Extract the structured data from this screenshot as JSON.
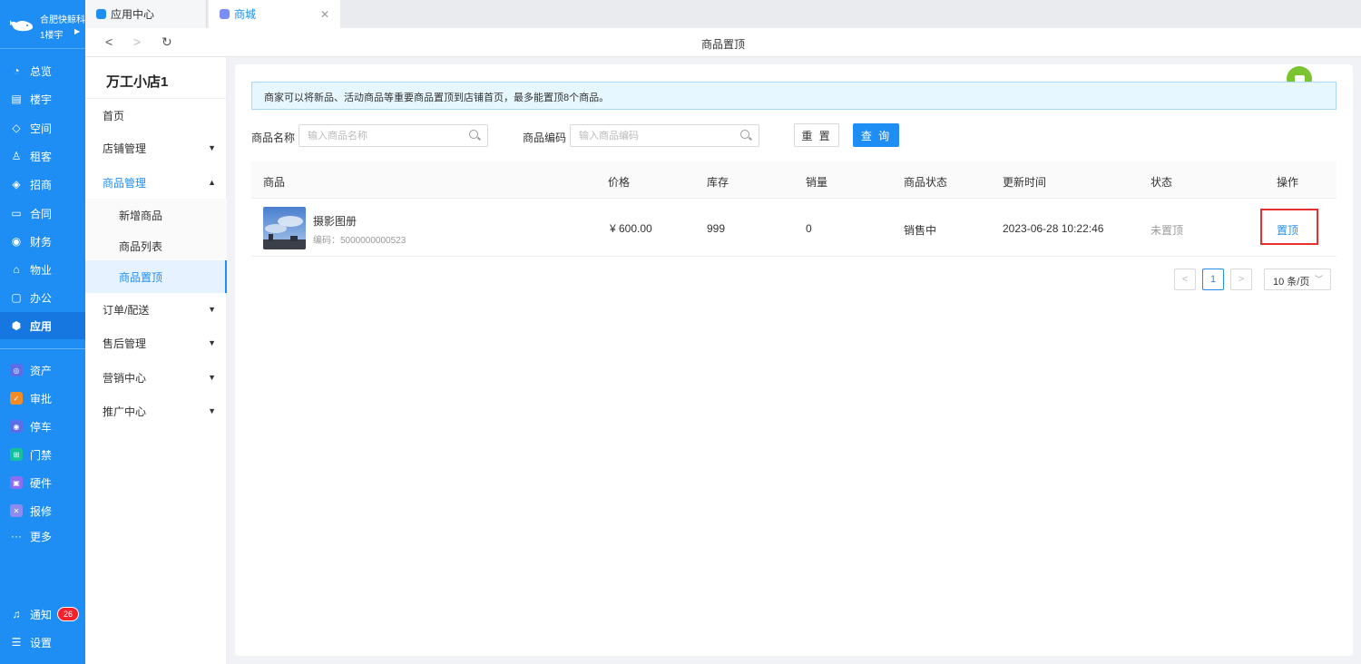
{
  "sidebar": {
    "brand": {
      "name": "合肥快鲸科",
      "building": "1楼宇"
    },
    "items": [
      {
        "label": "总览",
        "icon": "dashboard-icon"
      },
      {
        "label": "楼宇",
        "icon": "building-icon"
      },
      {
        "label": "空间",
        "icon": "cube-icon"
      },
      {
        "label": "租客",
        "icon": "user-icon"
      },
      {
        "label": "招商",
        "icon": "tag-icon"
      },
      {
        "label": "合同",
        "icon": "document-icon"
      },
      {
        "label": "财务",
        "icon": "finance-icon"
      },
      {
        "label": "物业",
        "icon": "home-icon"
      },
      {
        "label": "办公",
        "icon": "monitor-icon"
      },
      {
        "label": "应用",
        "icon": "app-icon"
      }
    ],
    "apps": [
      {
        "label": "资产",
        "color": "#5b6ee8"
      },
      {
        "label": "审批",
        "color": "#f28c28"
      },
      {
        "label": "停车",
        "color": "#5b6ee8"
      },
      {
        "label": "门禁",
        "color": "#12c29e"
      },
      {
        "label": "硬件",
        "color": "#8c6cf0"
      },
      {
        "label": "报修",
        "color": "#8c8cf0"
      }
    ],
    "more": "更多",
    "notify": {
      "label": "通知",
      "count": "26"
    },
    "settings": "设置"
  },
  "tabs": {
    "tab1": "应用中心",
    "tab2": "商城"
  },
  "page_title": "商品置顶",
  "menu": {
    "shop_name": "万工小店1",
    "items": {
      "home": "首页",
      "store": "店铺管理",
      "goods": "商品管理",
      "goods_add": "新增商品",
      "goods_list": "商品列表",
      "goods_top": "商品置顶",
      "orders": "订单/配送",
      "aftersale": "售后管理",
      "marketing": "营销中心",
      "promotion": "推广中心"
    }
  },
  "notice": "商家可以将新品、活动商品等重要商品置顶到店铺首页，最多能置顶8个商品。",
  "filters": {
    "name_label": "商品名称",
    "name_placeholder": "输入商品名称",
    "code_label": "商品编码",
    "code_placeholder": "输入商品编码",
    "reset": "重 置",
    "query": "查 询"
  },
  "table": {
    "headers": [
      "商品",
      "价格",
      "库存",
      "销量",
      "商品状态",
      "更新时间",
      "状态",
      "操作"
    ],
    "rows": [
      {
        "name": "摄影图册",
        "code": "编码：5000000000523",
        "price": "¥ 600.00",
        "stock": "999",
        "sales": "0",
        "goods_status": "销售中",
        "updated": "2023-06-28 10:22:46",
        "status": "未置顶",
        "action": "置顶"
      }
    ]
  },
  "pagination": {
    "prev": "<",
    "current": "1",
    "next": ">",
    "size": "10 条/页"
  }
}
